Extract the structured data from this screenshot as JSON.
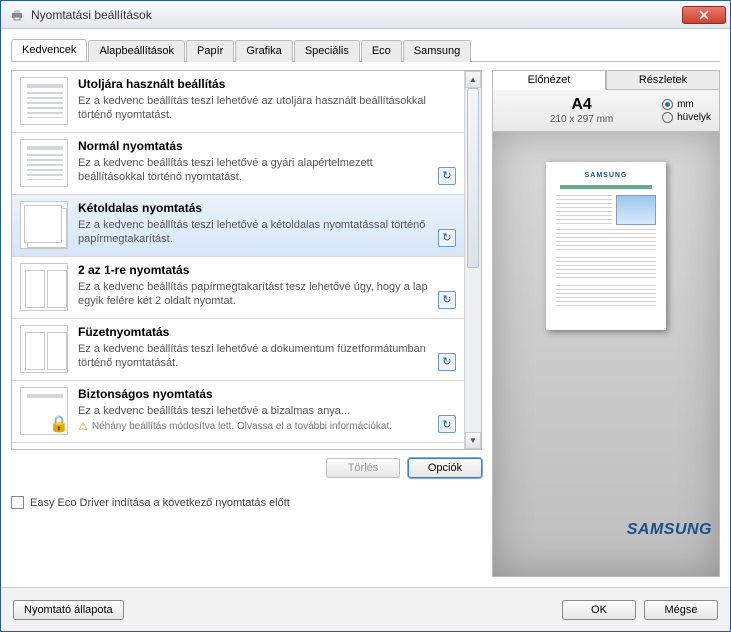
{
  "window": {
    "title": "Nyomtatási beállítások"
  },
  "tabs": [
    "Kedvencek",
    "Alapbeállítások",
    "Papír",
    "Grafika",
    "Speciális",
    "Eco",
    "Samsung"
  ],
  "activeTab": 0,
  "favorites": [
    {
      "title": "Utoljára használt beállítás",
      "desc": "Ez a kedvenc beállítás teszi lehetővé az utoljára használt beállításokkal történő nyomtatást.",
      "thumb": "single",
      "warn": null
    },
    {
      "title": "Normál nyomtatás",
      "desc": "Ez a kedvenc beállítás teszi lehetővé a gyári alapértelmezett beállításokkal történő nyomtatást.",
      "thumb": "single",
      "warn": null
    },
    {
      "title": "Kétoldalas nyomtatás",
      "desc": "Ez a kedvenc beállítás teszi lehetővé a kétoldalas nyomtatással történő papírmegtakarítást.",
      "thumb": "duplex",
      "warn": null
    },
    {
      "title": "2 az 1-re nyomtatás",
      "desc": "Ez a kedvenc beállítás papírmegtakarítást tesz lehetővé úgy, hogy a lap egyik felére két 2 oldalt nyomtat.",
      "thumb": "two-up",
      "warn": null
    },
    {
      "title": "Füzetnyomtatás",
      "desc": "Ez a kedvenc beállítás teszi lehetővé a dokumentum füzetformátumban történő nyomtatását.",
      "thumb": "two-up",
      "warn": null
    },
    {
      "title": "Biztonságos nyomtatás",
      "desc": "Ez a kedvenc beállítás teszi lehetővé a bizalmas anya...",
      "thumb": "secure",
      "warn": "Néhány beállítás módosítva lett. Olvassa el a további információkat."
    }
  ],
  "selectedFavorite": 2,
  "buttons": {
    "delete": "Törlés",
    "options": "Opciók"
  },
  "eco": {
    "label": "Easy Eco Driver indítása a következő nyomtatás előtt",
    "checked": false
  },
  "preview": {
    "tabs": [
      "Előnézet",
      "Részletek"
    ],
    "activeTab": 0,
    "paper": {
      "name": "A4",
      "dim": "210 x 297 mm"
    },
    "units": {
      "mm": "mm",
      "inch": "hüvelyk",
      "selected": "mm"
    }
  },
  "brand": "SAMSUNG",
  "bottom": {
    "status": "Nyomtató állapota",
    "ok": "OK",
    "cancel": "Mégse"
  }
}
